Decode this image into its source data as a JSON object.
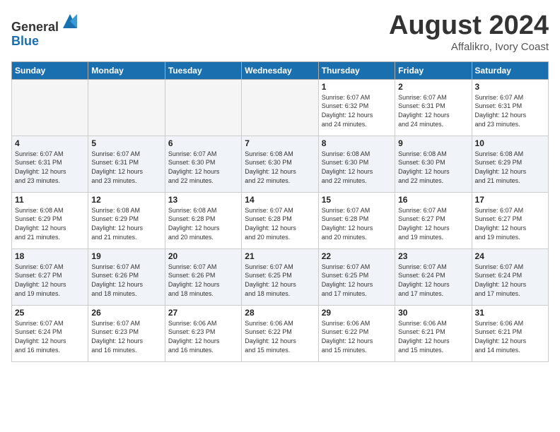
{
  "header": {
    "logo_line1": "General",
    "logo_line2": "Blue",
    "title": "August 2024",
    "subtitle": "Affalikro, Ivory Coast"
  },
  "days_of_week": [
    "Sunday",
    "Monday",
    "Tuesday",
    "Wednesday",
    "Thursday",
    "Friday",
    "Saturday"
  ],
  "weeks": [
    [
      {
        "num": "",
        "detail": "",
        "empty": true
      },
      {
        "num": "",
        "detail": "",
        "empty": true
      },
      {
        "num": "",
        "detail": "",
        "empty": true
      },
      {
        "num": "",
        "detail": "",
        "empty": true
      },
      {
        "num": "1",
        "detail": "Sunrise: 6:07 AM\nSunset: 6:32 PM\nDaylight: 12 hours\nand 24 minutes."
      },
      {
        "num": "2",
        "detail": "Sunrise: 6:07 AM\nSunset: 6:31 PM\nDaylight: 12 hours\nand 24 minutes."
      },
      {
        "num": "3",
        "detail": "Sunrise: 6:07 AM\nSunset: 6:31 PM\nDaylight: 12 hours\nand 23 minutes."
      }
    ],
    [
      {
        "num": "4",
        "detail": "Sunrise: 6:07 AM\nSunset: 6:31 PM\nDaylight: 12 hours\nand 23 minutes."
      },
      {
        "num": "5",
        "detail": "Sunrise: 6:07 AM\nSunset: 6:31 PM\nDaylight: 12 hours\nand 23 minutes."
      },
      {
        "num": "6",
        "detail": "Sunrise: 6:07 AM\nSunset: 6:30 PM\nDaylight: 12 hours\nand 22 minutes."
      },
      {
        "num": "7",
        "detail": "Sunrise: 6:08 AM\nSunset: 6:30 PM\nDaylight: 12 hours\nand 22 minutes."
      },
      {
        "num": "8",
        "detail": "Sunrise: 6:08 AM\nSunset: 6:30 PM\nDaylight: 12 hours\nand 22 minutes."
      },
      {
        "num": "9",
        "detail": "Sunrise: 6:08 AM\nSunset: 6:30 PM\nDaylight: 12 hours\nand 22 minutes."
      },
      {
        "num": "10",
        "detail": "Sunrise: 6:08 AM\nSunset: 6:29 PM\nDaylight: 12 hours\nand 21 minutes."
      }
    ],
    [
      {
        "num": "11",
        "detail": "Sunrise: 6:08 AM\nSunset: 6:29 PM\nDaylight: 12 hours\nand 21 minutes."
      },
      {
        "num": "12",
        "detail": "Sunrise: 6:08 AM\nSunset: 6:29 PM\nDaylight: 12 hours\nand 21 minutes."
      },
      {
        "num": "13",
        "detail": "Sunrise: 6:08 AM\nSunset: 6:28 PM\nDaylight: 12 hours\nand 20 minutes."
      },
      {
        "num": "14",
        "detail": "Sunrise: 6:07 AM\nSunset: 6:28 PM\nDaylight: 12 hours\nand 20 minutes."
      },
      {
        "num": "15",
        "detail": "Sunrise: 6:07 AM\nSunset: 6:28 PM\nDaylight: 12 hours\nand 20 minutes."
      },
      {
        "num": "16",
        "detail": "Sunrise: 6:07 AM\nSunset: 6:27 PM\nDaylight: 12 hours\nand 19 minutes."
      },
      {
        "num": "17",
        "detail": "Sunrise: 6:07 AM\nSunset: 6:27 PM\nDaylight: 12 hours\nand 19 minutes."
      }
    ],
    [
      {
        "num": "18",
        "detail": "Sunrise: 6:07 AM\nSunset: 6:27 PM\nDaylight: 12 hours\nand 19 minutes."
      },
      {
        "num": "19",
        "detail": "Sunrise: 6:07 AM\nSunset: 6:26 PM\nDaylight: 12 hours\nand 18 minutes."
      },
      {
        "num": "20",
        "detail": "Sunrise: 6:07 AM\nSunset: 6:26 PM\nDaylight: 12 hours\nand 18 minutes."
      },
      {
        "num": "21",
        "detail": "Sunrise: 6:07 AM\nSunset: 6:25 PM\nDaylight: 12 hours\nand 18 minutes."
      },
      {
        "num": "22",
        "detail": "Sunrise: 6:07 AM\nSunset: 6:25 PM\nDaylight: 12 hours\nand 17 minutes."
      },
      {
        "num": "23",
        "detail": "Sunrise: 6:07 AM\nSunset: 6:24 PM\nDaylight: 12 hours\nand 17 minutes."
      },
      {
        "num": "24",
        "detail": "Sunrise: 6:07 AM\nSunset: 6:24 PM\nDaylight: 12 hours\nand 17 minutes."
      }
    ],
    [
      {
        "num": "25",
        "detail": "Sunrise: 6:07 AM\nSunset: 6:24 PM\nDaylight: 12 hours\nand 16 minutes."
      },
      {
        "num": "26",
        "detail": "Sunrise: 6:07 AM\nSunset: 6:23 PM\nDaylight: 12 hours\nand 16 minutes."
      },
      {
        "num": "27",
        "detail": "Sunrise: 6:06 AM\nSunset: 6:23 PM\nDaylight: 12 hours\nand 16 minutes."
      },
      {
        "num": "28",
        "detail": "Sunrise: 6:06 AM\nSunset: 6:22 PM\nDaylight: 12 hours\nand 15 minutes."
      },
      {
        "num": "29",
        "detail": "Sunrise: 6:06 AM\nSunset: 6:22 PM\nDaylight: 12 hours\nand 15 minutes."
      },
      {
        "num": "30",
        "detail": "Sunrise: 6:06 AM\nSunset: 6:21 PM\nDaylight: 12 hours\nand 15 minutes."
      },
      {
        "num": "31",
        "detail": "Sunrise: 6:06 AM\nSunset: 6:21 PM\nDaylight: 12 hours\nand 14 minutes."
      }
    ]
  ]
}
